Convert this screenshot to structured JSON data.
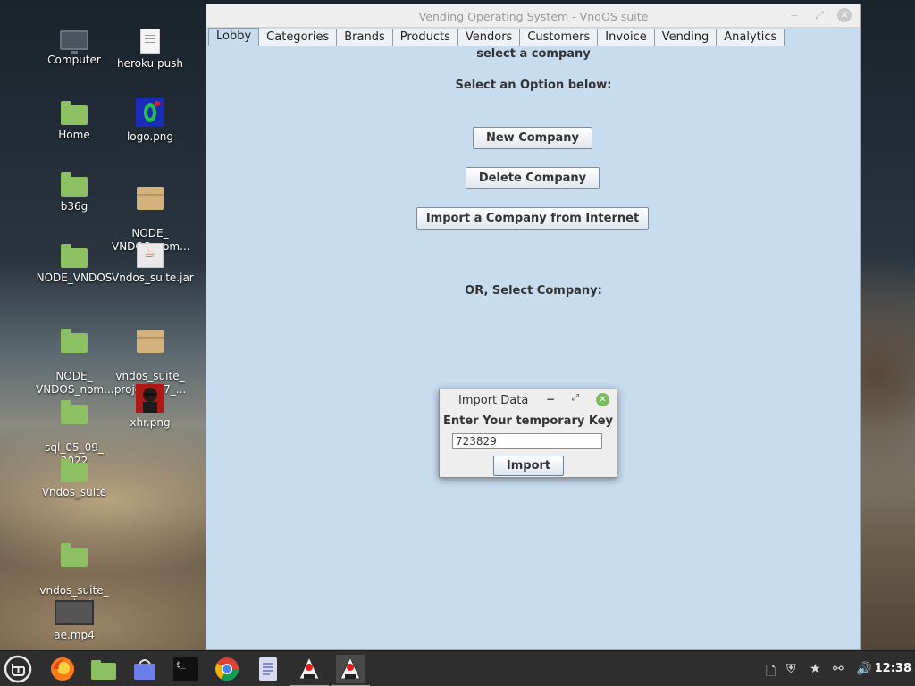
{
  "desktop": {
    "icons": [
      {
        "label": "Computer"
      },
      {
        "label": "heroku push"
      },
      {
        "label": "Home"
      },
      {
        "label": "logo.png"
      },
      {
        "label": "b36g"
      },
      {
        "label": "NODE_\nVNDOS_nom..."
      },
      {
        "label": "NODE_VNDOS"
      },
      {
        "label": "Vndos_suite.jar"
      },
      {
        "label": "NODE_\nVNDOS_nom..."
      },
      {
        "label": "vndos_suite_\nproject_07_..."
      },
      {
        "label": "sql_05_09_\n2022"
      },
      {
        "label": "xhr.png"
      },
      {
        "label": "Vndos_suite"
      },
      {
        "label": "vndos_suite_\nproject"
      },
      {
        "label": "ae.mp4"
      }
    ]
  },
  "window": {
    "title": "Vending Operating System - VndOS suite",
    "tabs": [
      "Lobby",
      "Categories",
      "Brands",
      "Products",
      "Vendors",
      "Customers",
      "Invoice",
      "Vending",
      "Analytics"
    ],
    "active_tab": "Lobby"
  },
  "lobby": {
    "heading_top": "select a company",
    "heading_option": "Select an Option below:",
    "new_company": "New Company",
    "delete_company": "Delete Company",
    "import_company": "Import a Company from Internet",
    "heading_or": "OR, Select Company:"
  },
  "dialog": {
    "title": "Import Data",
    "prompt": "Enter Your temporary Key",
    "key_value": "723829",
    "import_label": "Import"
  },
  "taskbar": {
    "clock": "12:38"
  },
  "colors": {
    "window_bg": "#c8dcf0",
    "taskbar_bg": "#2e2e2e",
    "accent_green": "#8cc063"
  }
}
